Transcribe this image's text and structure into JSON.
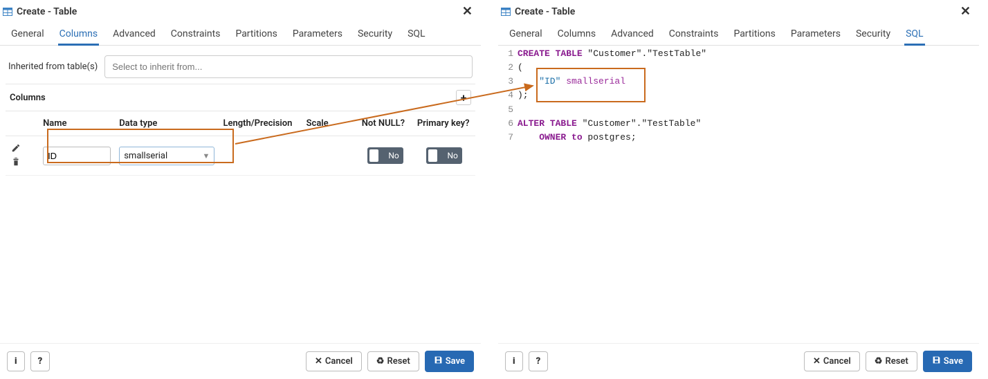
{
  "window": {
    "title": "Create - Table"
  },
  "tabs": [
    "General",
    "Columns",
    "Advanced",
    "Constraints",
    "Partitions",
    "Parameters",
    "Security",
    "SQL"
  ],
  "left": {
    "active_tab": "Columns",
    "inherit_label": "Inherited from table(s)",
    "inherit_placeholder": "Select to inherit from...",
    "columns_heading": "Columns",
    "headers": {
      "name": "Name",
      "type": "Data type",
      "length": "Length/Precision",
      "scale": "Scale",
      "notnull": "Not NULL?",
      "pk": "Primary key?"
    },
    "row": {
      "name_value": "ID",
      "type_value": "smallserial",
      "notnull_label": "No",
      "pk_label": "No"
    }
  },
  "right": {
    "active_tab": "SQL",
    "code": {
      "l1a": "CREATE TABLE",
      "l1b": " \"Customer\".\"TestTable\"",
      "l2": "(",
      "l3a": "    \"ID\" ",
      "l3b": "smallserial",
      "l4": ");",
      "l5": "",
      "l6a": "ALTER TABLE",
      "l6b": " \"Customer\".\"TestTable\"",
      "l7a": "    OWNER to",
      "l7b": " postgres;"
    }
  },
  "footer": {
    "info": "i",
    "help": "?",
    "cancel": "Cancel",
    "reset": "Reset",
    "save": "Save"
  }
}
